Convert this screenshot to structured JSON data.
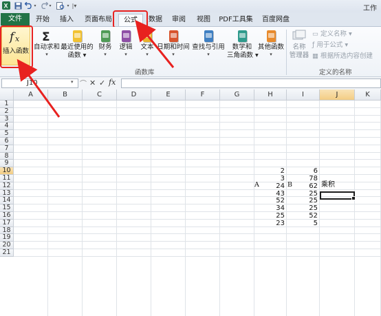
{
  "window": {
    "title": "工作"
  },
  "quick_access": {
    "icons": [
      "excel-logo-icon",
      "save-icon",
      "undo-icon",
      "redo-icon",
      "print-preview-icon",
      "customize-icon"
    ]
  },
  "tabs": [
    "文件",
    "开始",
    "插入",
    "页面布局",
    "公式",
    "数据",
    "审阅",
    "视图",
    "PDF工具集",
    "百度网盘"
  ],
  "ribbon": {
    "insert_function": "插入函数",
    "autosum": "自动求和",
    "recent_line1": "最近使用的",
    "recent_line2": "函数",
    "financial": "财务",
    "logical": "逻辑",
    "text": "文本",
    "datetime": "日期和时间",
    "lookup": "查找与引用",
    "math_line1": "数学和",
    "math_line2": "三角函数",
    "more": "其他函数",
    "name_manager_line1": "名称",
    "name_manager_line2": "管理器",
    "define_name": "定义名称",
    "use_in_formula": "用于公式",
    "create_from_selection": "根据所选内容创建",
    "group_function_library": "函数库",
    "group_defined_names": "定义的名称"
  },
  "formula_bar": {
    "name_box": "J10",
    "fx": "fx",
    "formula": ""
  },
  "grid": {
    "columns": [
      "A",
      "B",
      "C",
      "D",
      "E",
      "F",
      "G",
      "H",
      "I",
      "J",
      "K"
    ],
    "rows": [
      "1",
      "2",
      "3",
      "4",
      "5",
      "6",
      "7",
      "8",
      "9",
      "10",
      "11",
      "12",
      "13",
      "14",
      "15",
      "16",
      "17",
      "18",
      "19",
      "20",
      "21"
    ],
    "selected_cell": "J10",
    "headers": {
      "H9": "A",
      "I9": "B",
      "J9": "乘积"
    },
    "col_h": [
      "2",
      "3",
      "24",
      "43",
      "52",
      "34",
      "25",
      "23"
    ],
    "col_i": [
      "6",
      "78",
      "62",
      "25",
      "25",
      "25",
      "52",
      "5"
    ]
  },
  "colors": {
    "file_tab": "#217346",
    "highlight": "#e8211f",
    "selection": "#f3cd84"
  }
}
